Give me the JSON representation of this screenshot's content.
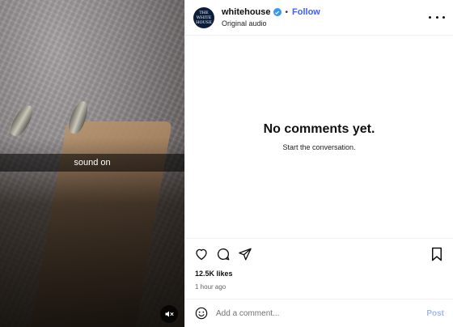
{
  "media": {
    "sound_banner": "sound on",
    "mute_icon": "speaker-muted-icon"
  },
  "header": {
    "avatar_text": "THE WHITE HOUSE",
    "username": "whitehouse",
    "separator": "•",
    "follow_label": "Follow",
    "audio_label": "Original audio"
  },
  "comments": {
    "empty_title": "No comments yet.",
    "empty_subtitle": "Start the conversation."
  },
  "actions": {
    "icons": [
      "heart-icon",
      "comment-icon",
      "share-icon",
      "bookmark-icon"
    ]
  },
  "stats": {
    "likes": "12.5K likes",
    "time": "1 hour ago"
  },
  "composer": {
    "placeholder": "Add a comment...",
    "post_label": "Post"
  },
  "colors": {
    "accent": "#3f5ef5",
    "verified": "#3897f0",
    "post_disabled": "#9fb7f9"
  }
}
